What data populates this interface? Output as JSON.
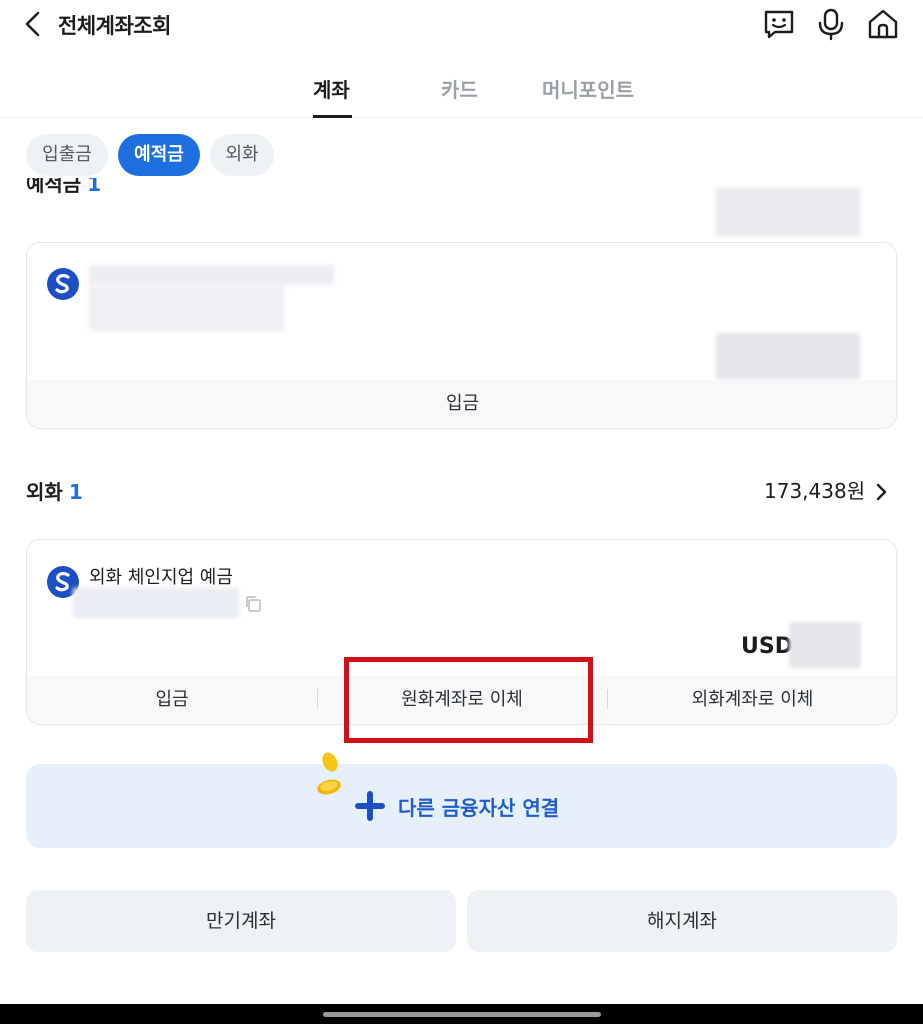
{
  "header": {
    "title": "전체계좌조회",
    "icons": [
      "back-icon",
      "chatbot-icon",
      "microphone-icon",
      "home-icon"
    ]
  },
  "tabs": [
    {
      "label": "계좌",
      "active": true
    },
    {
      "label": "카드",
      "active": false
    },
    {
      "label": "머니포인트",
      "active": false
    }
  ],
  "filters": [
    {
      "label": "입출금",
      "active": false
    },
    {
      "label": "예적금",
      "active": true
    },
    {
      "label": "외화",
      "active": false
    }
  ],
  "deposit_section": {
    "title": "예적금",
    "count": "1",
    "account_card": {
      "footer_button": "입금"
    }
  },
  "fx_section": {
    "title": "외화",
    "count": "1",
    "total": "173,438원",
    "account_card": {
      "name": "외화 체인지업 예금",
      "currency": "USD",
      "buttons": [
        "입금",
        "원화계좌로 이체",
        "외화계좌로 이체"
      ]
    }
  },
  "link_asset": {
    "label": "다른 금융자산 연결"
  },
  "bottom_buttons": [
    "만기계좌",
    "해지계좌"
  ],
  "colors": {
    "accent": "#1d6fe0",
    "highlight": "#d0111a",
    "link_bg": "#e6f0fb"
  }
}
